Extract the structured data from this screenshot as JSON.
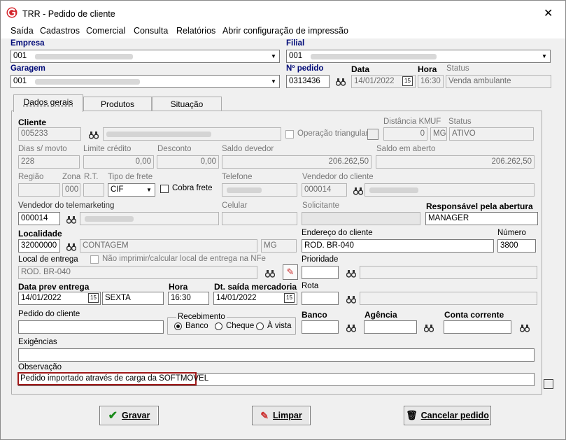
{
  "window": {
    "title": "TRR - Pedido de cliente"
  },
  "menu": [
    "Saída",
    "Cadastros",
    "Comercial",
    "Consulta",
    "Relatórios",
    "Abrir configuração de impressão"
  ],
  "header": {
    "empresa_label": "Empresa",
    "empresa_value": "001",
    "filial_label": "Filial",
    "filial_value": "001",
    "garagem_label": "Garagem",
    "garagem_value": "001",
    "pedido_label": "Nº pedido",
    "pedido_value": "0313436",
    "data_label": "Data",
    "data_value": "14/01/2022",
    "hora_label": "Hora",
    "hora_value": "16:30",
    "status_label": "Status",
    "status_value": "Venda ambulante"
  },
  "tabs": [
    "Dados gerais",
    "Produtos",
    "Situação"
  ],
  "form": {
    "cliente_label": "Cliente",
    "cliente_value": "005233",
    "operacao_triangular": "Operação triangular",
    "distancia_label": "Distância KM",
    "distancia_value": "0",
    "uf_label": "UF",
    "uf_value": "MG",
    "status_label": "Status",
    "status_value": "ATIVO",
    "dias_label": "Dias s/ movto",
    "dias_value": "228",
    "limite_label": "Limite crédito",
    "limite_value": "0,00",
    "desconto_label": "Desconto",
    "desconto_value": "0,00",
    "saldo_devedor_label": "Saldo devedor",
    "saldo_devedor_value": "206.262,50",
    "saldo_aberto_label": "Saldo em aberto",
    "saldo_aberto_value": "206.262,50",
    "regiao_label": "Região",
    "zona_label": "Zona",
    "zona_value": "000",
    "rt_label": "R.T.",
    "tipo_frete_label": "Tipo de frete",
    "tipo_frete_value": "CIF",
    "cobra_frete": "Cobra frete",
    "telefone_label": "Telefone",
    "vendedor_cliente_label": "Vendedor do cliente",
    "vendedor_cliente_value": "000014",
    "vendedor_tele_label": "Vendedor do telemarketing",
    "vendedor_tele_value": "000014",
    "celular_label": "Celular",
    "solicitante_label": "Solicitante",
    "responsavel_label": "Responsável pela abertura",
    "responsavel_value": "MANAGER",
    "localidade_label": "Localidade",
    "localidade_value": "32000000",
    "localidade_nome": "CONTAGEM",
    "localidade_uf": "MG",
    "endereco_label": "Endereço do cliente",
    "endereco_value": "ROD. BR-040",
    "numero_label": "Número",
    "numero_value": "3800",
    "local_entrega_label": "Local de entrega",
    "local_entrega_value": "ROD. BR-040",
    "nao_imprimir": "Não imprimir/calcular local de entrega na NFe",
    "prioridade_label": "Prioridade",
    "data_prev_label": "Data prev entrega",
    "data_prev_value": "14/01/2022",
    "dia_semana": "SEXTA",
    "hora_label": "Hora",
    "hora_value": "16:30",
    "dt_saida_label": "Dt. saída mercadoria",
    "dt_saida_value": "14/01/2022",
    "rota_label": "Rota",
    "pedido_cliente_label": "Pedido do cliente",
    "recebimento_label": "Recebimento",
    "recebimento_opcoes": [
      "Banco",
      "Cheque",
      "À vista"
    ],
    "banco_label": "Banco",
    "agencia_label": "Agência",
    "conta_label": "Conta corrente",
    "exigencias_label": "Exigências",
    "observacao_label": "Observação",
    "observacao_value": "Pedido importado através de carga da SOFTMOVEL"
  },
  "buttons": {
    "gravar": "Gravar",
    "limpar": "Limpar",
    "cancelar": "Cancelar pedido"
  },
  "colors": {
    "label_blue": "#000a78",
    "highlight_red": "#a01818",
    "logo_red": "#d4232a"
  }
}
